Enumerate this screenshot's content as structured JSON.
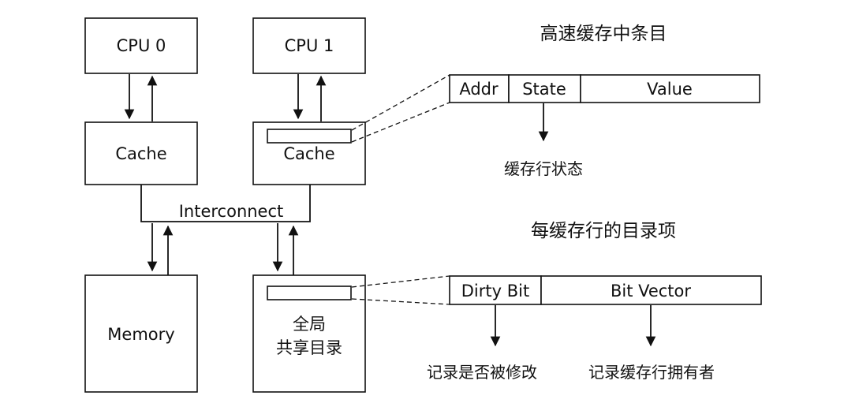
{
  "components": {
    "cpu0": "CPU 0",
    "cpu1": "CPU 1",
    "cache0": "Cache",
    "cache1": "Cache",
    "interconnect": "Interconnect",
    "memory": "Memory",
    "directory_line1": "全局",
    "directory_line2": "共享目录"
  },
  "cache_entry": {
    "heading": "高速缓存中条目",
    "fields": [
      "Addr",
      "State",
      "Value"
    ],
    "state_note": "缓存行状态"
  },
  "directory_entry": {
    "heading": "每缓存行的目录项",
    "fields": [
      "Dirty Bit",
      "Bit Vector"
    ],
    "dirty_note": "记录是否被修改",
    "vector_note": "记录缓存行拥有者"
  }
}
